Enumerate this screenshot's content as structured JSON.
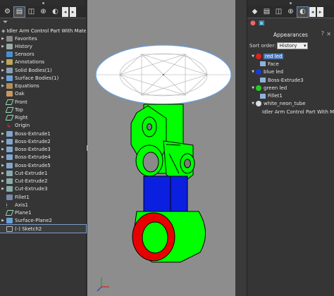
{
  "left_panel": {
    "tabs": [
      {
        "name": "feature-manager-tab",
        "icon": "gear-icon",
        "glyph": "⚙"
      },
      {
        "name": "property-manager-tab",
        "icon": "list-icon",
        "glyph": "▤"
      },
      {
        "name": "configuration-manager-tab",
        "icon": "config-icon",
        "glyph": "◫"
      },
      {
        "name": "dimxpert-tab",
        "icon": "crosshair-icon",
        "glyph": "⊕"
      },
      {
        "name": "display-manager-tab",
        "icon": "display-icon",
        "glyph": "◐"
      }
    ],
    "filter_icon": "funnel-icon",
    "root_label": "Idler Arm Control Part With Material (Def",
    "items": [
      {
        "label": "Favorites",
        "expand": "▶",
        "icon": "ico-fav"
      },
      {
        "label": "History",
        "expand": "▶",
        "icon": "ico-hist"
      },
      {
        "label": "Sensors",
        "expand": "",
        "icon": "ico-sens"
      },
      {
        "label": "Annotations",
        "expand": "▶",
        "icon": "ico-ann"
      },
      {
        "label": "Solid Bodies(1)",
        "expand": "▶",
        "icon": "ico-solid"
      },
      {
        "label": "Surface Bodies(1)",
        "expand": "▶",
        "icon": "ico-surf"
      },
      {
        "label": "Equations",
        "expand": "▶",
        "icon": "ico-eq"
      },
      {
        "label": "Oak",
        "expand": "",
        "icon": "ico-mat"
      },
      {
        "label": "Front",
        "expand": "",
        "icon": "ico-plane"
      },
      {
        "label": "Top",
        "expand": "",
        "icon": "ico-plane"
      },
      {
        "label": "Right",
        "expand": "",
        "icon": "ico-plane"
      },
      {
        "label": "Origin",
        "expand": "",
        "icon": "ico-orig"
      },
      {
        "label": "Boss-Extrude1",
        "expand": "▶",
        "icon": "ico-boss"
      },
      {
        "label": "Boss-Extrude2",
        "expand": "▶",
        "icon": "ico-boss"
      },
      {
        "label": "Boss-Extrude3",
        "expand": "▶",
        "icon": "ico-boss"
      },
      {
        "label": "Boss-Extrude4",
        "expand": "▶",
        "icon": "ico-boss"
      },
      {
        "label": "Boss-Extrude5",
        "expand": "▶",
        "icon": "ico-boss"
      },
      {
        "label": "Cut-Extrude1",
        "expand": "▶",
        "icon": "ico-cut"
      },
      {
        "label": "Cut-Extrude2",
        "expand": "▶",
        "icon": "ico-cut"
      },
      {
        "label": "Cut-Extrude3",
        "expand": "▶",
        "icon": "ico-cut"
      },
      {
        "label": "Fillet1",
        "expand": "",
        "icon": "ico-fillet"
      },
      {
        "label": "Axis1",
        "expand": "",
        "icon": "ico-axis"
      },
      {
        "label": "Plane1",
        "expand": "",
        "icon": "ico-plane"
      },
      {
        "label": "Surface-Plane2",
        "expand": "▶",
        "icon": "ico-surf"
      },
      {
        "label": "(-) Sketch2",
        "expand": "",
        "icon": "ico-sketch",
        "selected": true
      }
    ]
  },
  "right_panel": {
    "tabs_row1": [
      {
        "name": "rp-tab-appearances",
        "glyph": "◆"
      },
      {
        "name": "rp-tab-list",
        "glyph": "▤"
      },
      {
        "name": "rp-tab-config",
        "glyph": "◫"
      },
      {
        "name": "rp-tab-target",
        "glyph": "⊕"
      },
      {
        "name": "rp-tab-display",
        "glyph": "◐"
      }
    ],
    "title": "Appearances",
    "help_icon": "?",
    "close_icon": "✕",
    "sort_label": "Sort order:",
    "sort_value": "History",
    "items": [
      {
        "label": "red led",
        "ball": "#e02020",
        "expand": "▼",
        "level": 0,
        "highlight": true
      },
      {
        "label": "Face",
        "level": 1
      },
      {
        "label": "blue led",
        "ball": "#1a3ad8",
        "expand": "▼",
        "level": 0
      },
      {
        "label": "Boss-Extrude3",
        "level": 1
      },
      {
        "label": "green led",
        "ball": "#1fcf1f",
        "expand": "▼",
        "level": 0
      },
      {
        "label": "Fillet1",
        "level": 1
      },
      {
        "label": "white_neon_tube",
        "ball": "#dddddd",
        "expand": "▼",
        "level": 0
      },
      {
        "label": "Idler Arm Control Part With Ma",
        "level": 1
      }
    ]
  },
  "colors": {
    "green": "#00ff00",
    "blue": "#0a1fe0",
    "red": "#e80000",
    "viewport_bg": "#8d8d8d",
    "panel_bg": "#353535",
    "selection": "#4e79b4"
  }
}
